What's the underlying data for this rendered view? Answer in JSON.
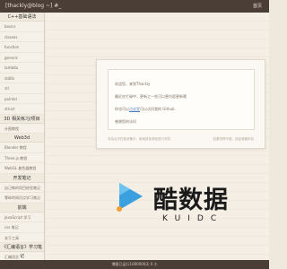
{
  "topbar": {
    "title": "[thackly@blog ~] #_",
    "right_link": "首页"
  },
  "sidebar": {
    "sections": [
      {
        "heading": "C++基础语法",
        "items": [
          "basics",
          "classes",
          "function",
          "generic",
          "lambda",
          "stdlib",
          "stl",
          "pointer",
          "struct"
        ]
      },
      {
        "heading": "3D 相关练习/项目",
        "items": [
          "计图教程"
        ]
      },
      {
        "heading": "Web3d",
        "items": [
          "Blender 教程",
          "Three.js 教程",
          "WebGL 着色器教程"
        ]
      },
      {
        "heading": "开发笔记",
        "items": [
          "自己做的项目经验笔记",
          "零碎的知识点学习笔记"
        ]
      },
      {
        "heading": "前端",
        "items": [
          "JavaScript 学习",
          "css 笔记",
          "关于工具"
        ]
      },
      {
        "heading": "《汇编语言》学习笔记",
        "items": [
          "汇编语言"
        ]
      }
    ]
  },
  "card": {
    "line1": "欢迎您，来到Thackly",
    "line2": "最近在忙碌中，更新之一些可以更内容更新哦",
    "line3_prefix": "你也可以",
    "line3_link": "点这里",
    "line3_suffix": "可以访问我的 Github",
    "line4": "感谢您的访问",
    "foot_left": "本站点可在各设备中，使用鼠标滚轮进行浏览",
    "foot_right": "如果觉得不错，欢迎收藏本站"
  },
  "watermark": {
    "title": "酷数据",
    "subtitle": "KUIDC"
  },
  "bottombar": {
    "text": "博客已运行1000000天 0 小"
  },
  "colors": {
    "bar": "#4a3e36",
    "page_bg": "#efe8dc",
    "sidebar_bg": "#f6f1e8",
    "link": "#4b7cc0",
    "logo_blue": "#3aa0e0"
  }
}
